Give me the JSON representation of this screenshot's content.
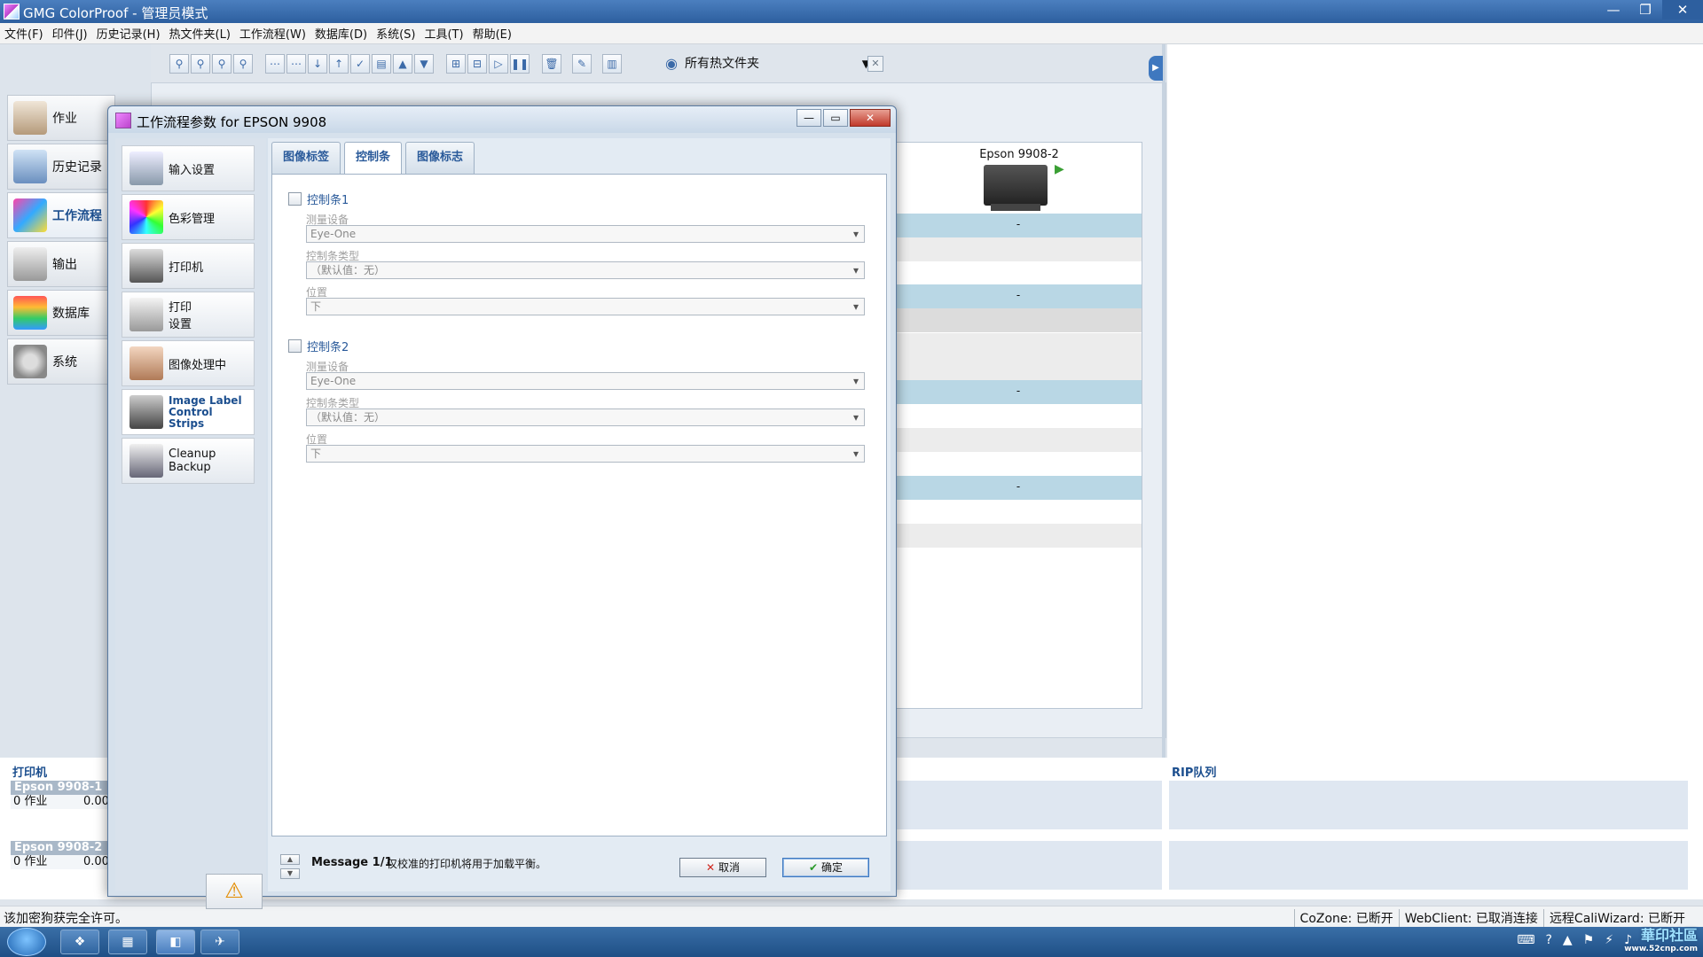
{
  "window": {
    "title": "GMG ColorProof - 管理员模式"
  },
  "menu": [
    "文件(F)",
    "印件(J)",
    "历史记录(H)",
    "热文件夹(L)",
    "工作流程(W)",
    "数据库(D)",
    "系统(S)",
    "工具(T)",
    "帮助(E)"
  ],
  "leftnav": {
    "items": [
      {
        "label": "作业",
        "icon": "job-icon"
      },
      {
        "label": "历史记录",
        "icon": "history-icon"
      },
      {
        "label": "工作流程",
        "icon": "workflow-icon",
        "active": true
      },
      {
        "label": "输出",
        "icon": "output-icon"
      },
      {
        "label": "数据库",
        "icon": "database-icon"
      },
      {
        "label": "系统",
        "icon": "system-gear-icon"
      }
    ]
  },
  "toolbar": {
    "hotfolder_select": "所有热文件夹"
  },
  "printer_card": {
    "name": "Epson 9908-2",
    "dash": "-"
  },
  "bottom": {
    "printers_title": "打印机",
    "rip_title": "RIP队列",
    "printers": [
      {
        "name": "Epson 9908-1",
        "jobs": "0 作业",
        "value": "0.00"
      },
      {
        "name": "Epson 9908-2",
        "jobs": "0 作业",
        "value": "0.00"
      }
    ]
  },
  "statusbar": {
    "left": "该加密狗获完全许可。",
    "cozone": "CoZone: 已断开",
    "webclient": "WebClient: 已取消连接",
    "caliwizard": "远程CaliWizard: 已断开"
  },
  "watermark": {
    "main": "華印社區",
    "sub": "www.52cnp.com"
  },
  "dialog": {
    "title": "工作流程参数 for EPSON 9908",
    "sidebar": [
      {
        "label": "输入设置",
        "icon": "input-settings-icon"
      },
      {
        "label": "色彩管理",
        "icon": "color-management-icon"
      },
      {
        "label": "打印机",
        "icon": "printer-icon"
      },
      {
        "label": "打印\n设置",
        "icon": "print-settings-icon"
      },
      {
        "label": "图像处理中",
        "icon": "image-processing-icon"
      },
      {
        "label": "Image Label\nControl\nStrips",
        "icon": "control-strips-icon",
        "active": true
      },
      {
        "label": "Cleanup\nBackup",
        "icon": "cleanup-backup-icon"
      }
    ],
    "tabs": [
      {
        "label": "图像标签"
      },
      {
        "label": "控制条",
        "active": true
      },
      {
        "label": "图像标志"
      }
    ],
    "strip1": {
      "checkbox_label": "控制条1",
      "device_label": "测量设备",
      "device_value": "Eye-One",
      "type_label": "控制条类型",
      "type_value": "（默认值：无）",
      "position_label": "位置",
      "position_value": "下"
    },
    "strip2": {
      "checkbox_label": "控制条2",
      "device_label": "测量设备",
      "device_value": "Eye-One",
      "type_label": "控制条类型",
      "type_value": "（默认值：无）",
      "position_label": "位置",
      "position_value": "下"
    },
    "message": {
      "title": "Message 1/1",
      "text": "仅校准的打印机将用于加载平衡。"
    },
    "buttons": {
      "cancel": "取消",
      "ok": "确定"
    }
  }
}
